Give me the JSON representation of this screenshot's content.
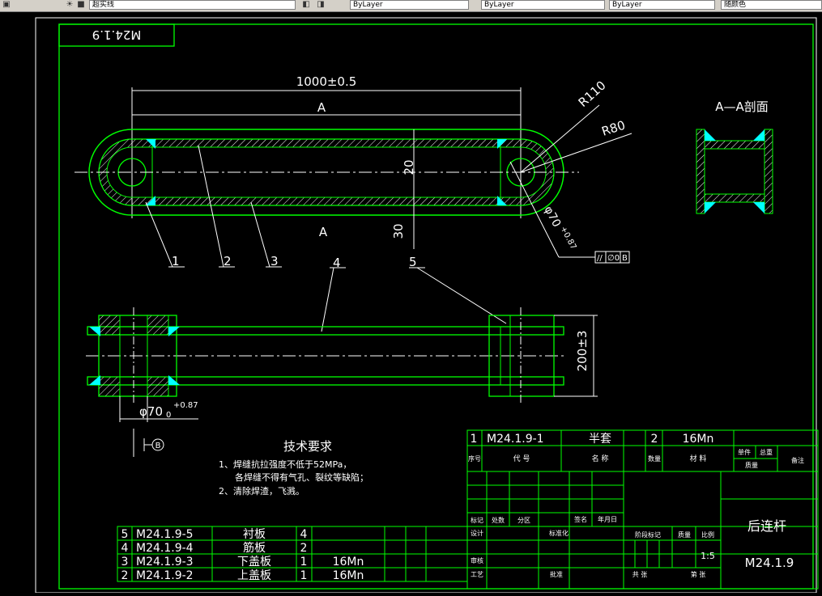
{
  "toolbar": {
    "layer_combo": "超实线",
    "color_combo": "ByLayer",
    "linetype_combo": "ByLayer",
    "lineweight_combo": "ByLayer",
    "plotstyle_combo": "随颜色"
  },
  "drawing": {
    "code_box": "M24.1.9",
    "dim_length": "1000±0.5",
    "section_mark": "A",
    "dim_20": "20",
    "dim_30": "30",
    "radius_1": "R110",
    "radius_2": "R80",
    "dia_main": "φ70",
    "dia_sup": "+0.87",
    "dia_sub": "0",
    "tolerance_frame": "//",
    "tolerance_value": "∅0",
    "tolerance_datum": "B",
    "dim_200": "200±3",
    "datum_label": "B",
    "section_title": "A—A剖面",
    "balloons": [
      "1",
      "2",
      "3",
      "4",
      "5"
    ]
  },
  "tech_requirements": {
    "title": "技术要求",
    "lines": [
      "1、焊缝抗拉强度不低于52MPa，",
      "各焊缝不得有气孔、裂纹等缺陷；",
      "2、清除焊渣，飞溅。"
    ]
  },
  "bom_right": {
    "row": {
      "no": "1",
      "code": "M24.1.9-1",
      "name": "半套",
      "qty": "2",
      "material": "16Mn"
    },
    "headers": {
      "no": "序号",
      "code": "代  号",
      "name": "名  称",
      "qty": "数量",
      "material": "材  料",
      "unit_weight": "单件",
      "total_weight": "总重",
      "mass": "质量",
      "remark": "备注"
    }
  },
  "bom_left": [
    {
      "no": "5",
      "code": "M24.1.9-5",
      "name": "衬板",
      "qty": "4",
      "material": ""
    },
    {
      "no": "4",
      "code": "M24.1.9-4",
      "name": "筋板",
      "qty": "2",
      "material": ""
    },
    {
      "no": "3",
      "code": "M24.1.9-3",
      "name": "下盖板",
      "qty": "1",
      "material": "16Mn"
    },
    {
      "no": "2",
      "code": "M24.1.9-2",
      "name": "上盖板",
      "qty": "1",
      "material": "16Mn"
    }
  ],
  "title_block": {
    "labels": {
      "mark": "标记",
      "qty": "处数",
      "zone": "分区",
      "sign": "签名",
      "date": "年月日",
      "design": "设计",
      "standardize": "标准化",
      "review": "审核",
      "process": "工艺",
      "approve": "批准",
      "stage": "阶段标记",
      "weight": "质量",
      "scale": "比例",
      "total": "共  张",
      "sheet": "第  张"
    },
    "part_name": "后连杆",
    "scale_value": "1:5",
    "drawing_number": "M24.1.9"
  },
  "colors": {
    "frame": "#ffffff",
    "outline": "#00ff00",
    "dimension": "#ffffff",
    "weld": "#00ffff",
    "text": "#ffffff"
  }
}
